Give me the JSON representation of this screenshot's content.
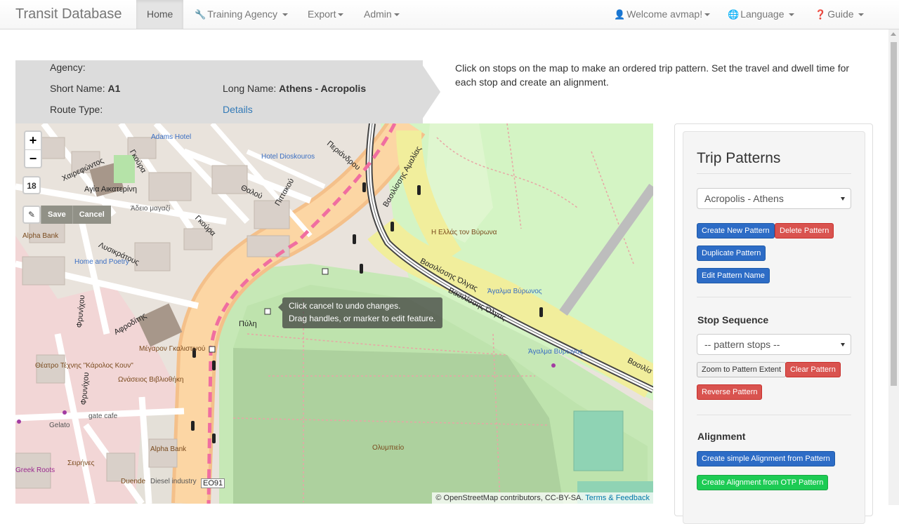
{
  "nav": {
    "brand": "Transit Database",
    "home": "Home",
    "training_agency": "Training Agency",
    "export": "Export",
    "admin": "Admin",
    "welcome": "Welcome avmap!",
    "language": "Language",
    "guide": "Guide"
  },
  "route": {
    "agency_label": "Agency:",
    "agency_value": "",
    "short_name_label": "Short Name:",
    "short_name_value": "A1",
    "long_name_label": "Long Name:",
    "long_name_value": "Athens - Acropolis",
    "route_type_label": "Route Type:",
    "details_link": "Details"
  },
  "instructions": "Click on stops on the map to make an ordered trip pattern. Set the travel and dwell time for each stop and create an alignment.",
  "map": {
    "zoom_in": "+",
    "zoom_out": "−",
    "zoom_level": "18",
    "save": "Save",
    "cancel": "Cancel",
    "tooltip_line1": "Click cancel to undo changes.",
    "tooltip_line2": "Drag handles, or marker to edit feature.",
    "attribution": "© OpenStreetMap contributors, CC-BY-SA.",
    "attribution_link": "Terms & Feedback",
    "labels": {
      "adams_hotel": "Adams Hotel",
      "hotel_dioskouros": "Hotel Dioskouros",
      "agia_aikaterini": "Αγία Αικατερίνη",
      "adeio_magazi": "Άδειο μαγαζί",
      "alpha_bank": "Alpha Bank",
      "home_and_poetry": "Home and Poetry",
      "greece_byron": "Η Ελλάς τον Βύρωνα",
      "agalma_byronos_1": "Άγαλμα Βύρωνος",
      "agalma_byronos_2": "Άγαλμα Βύρωνος",
      "megaron": "Μέγαρον Γκαλιστινού",
      "theatro": "Θέατρο Τέχνης \"Κάρολος Κουν\"",
      "onasios": "Ωνάσειος Βιβλιοθήκη",
      "gate_cafe": "gate cafe",
      "gelato": "Gelato",
      "alpha_bank_2": "Alpha Bank",
      "seirines": "Σειρήνες",
      "duende": "Duende",
      "diesel": "Diesel industry",
      "greek_roots": "Greek Roots",
      "olympieio": "Ολυμπιείο",
      "vasilissis_olgas_1": "Βασιλίσσης Όλγας",
      "vasilissis_olgas_2": "Βασιλίσσης Όλγας",
      "vasilissis_amalias": "Βασιλίσσης Αμαλίας",
      "periandrou": "Περιάνδρου",
      "thalou": "Θαλού",
      "pittakou": "Πιττακού",
      "goura_1": "Γκούρα",
      "goura_2": "Γκούρα",
      "lysikratous": "Λυσικράτους",
      "chaireofontos": "Χαιρεφώντος",
      "frynichou_1": "Φρυνίχου",
      "frynichou_2": "Φρυνίχου",
      "afroditis": "Αφροδίτης",
      "pyli": "Πύλη",
      "route_ref": "EO91",
      "vasilissis_short": "Βασιλίσ"
    }
  },
  "panel": {
    "title": "Trip Patterns",
    "pattern_select": "Acropolis - Athens",
    "create_new": "Create New Pattern",
    "delete": "Delete Pattern",
    "duplicate": "Duplicate Pattern",
    "edit_name": "Edit Pattern Name",
    "stop_sequence_heading": "Stop Sequence",
    "stops_select": "-- pattern stops --",
    "zoom_extent": "Zoom to Pattern Extent",
    "clear": "Clear Pattern",
    "reverse": "Reverse Pattern",
    "alignment_heading": "Alignment",
    "simple_alignment": "Create simple Alignment from Pattern",
    "otp_alignment": "Create Alignment from OTP Pattern"
  }
}
